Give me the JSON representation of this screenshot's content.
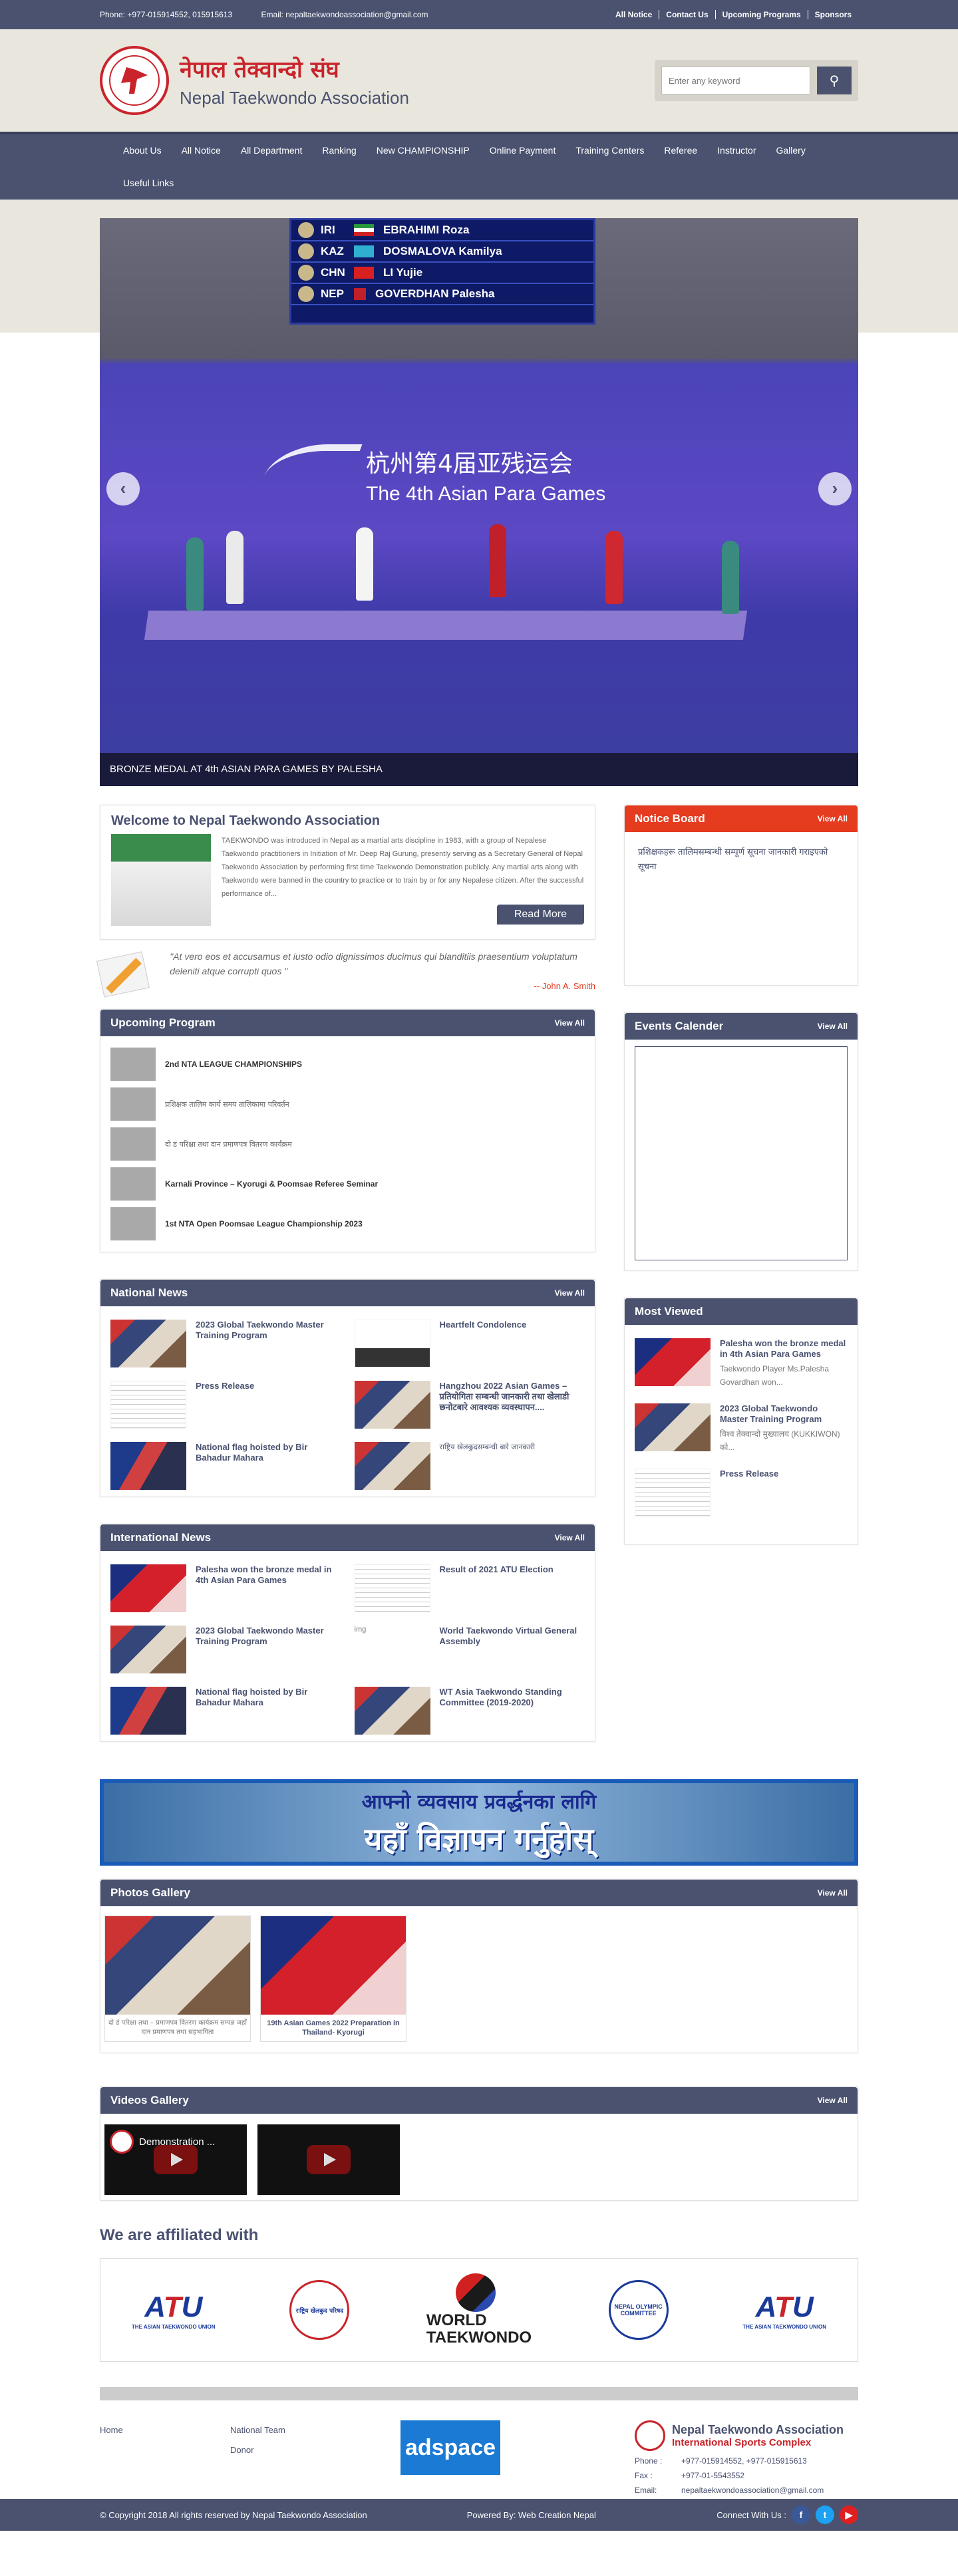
{
  "topbar": {
    "phone": "Phone: +977-015914552, 015915613",
    "email": "Email: nepaltaekwondoassociation@gmail.com",
    "links": [
      "All Notice",
      "Contact Us",
      "Upcoming Programs",
      "Sponsors"
    ]
  },
  "header": {
    "title_np": "नेपाल तेक्वान्दो संघ",
    "title_en": "Nepal Taekwondo Association",
    "search_placeholder": "Enter any keyword"
  },
  "nav": [
    "About Us",
    "All Notice",
    "All Department",
    "Ranking",
    "New CHAMPIONSHIP",
    "Online Payment",
    "Training Centers",
    "Referee",
    "Instructor",
    "Gallery",
    "Useful Links"
  ],
  "slider": {
    "caption": "BRONZE MEDAL AT 4th ASIAN PARA GAMES BY PALESHA",
    "scoreboard": [
      {
        "code": "IRI",
        "name": "EBRAHIMI Roza"
      },
      {
        "code": "KAZ",
        "name": "DOSMALOVA Kamilya"
      },
      {
        "code": "CHN",
        "name": "LI Yujie"
      },
      {
        "code": "NEP",
        "name": "GOVERDHAN Palesha"
      }
    ],
    "games_cn": "杭州第4届亚残运会",
    "games_en": "The 4th Asian Para Games"
  },
  "welcome": {
    "title": "Welcome to Nepal Taekwondo Association",
    "text": "TAEKWONDO was introduced in Nepal as a martial arts discipline in 1983, with a group of Nepalese Taekwondo practitioners in Initiation of Mr. Deep Raj Gurung, presently serving as a Secretary General of Nepal Taekwondo Association by performing first time Taekwondo Demonstration publicly. Any martial arts along with Taekwondo were banned in the country to practice or to train by or for any Nepalese citizen. After the successful performance of...",
    "read_more": "Read More"
  },
  "quote": {
    "text": "\"At vero eos et accusamus et iusto odio dignissimos ducimus qui blanditiis praesentium voluptatum deleniti atque corrupti quos \"",
    "author": "-- John A. Smith"
  },
  "upcoming": {
    "title": "Upcoming Program",
    "view_all": "View All",
    "items": [
      {
        "text": "2nd NTA LEAGUE CHAMPIONSHIPS",
        "np": false
      },
      {
        "text": "प्रशिक्षक तालिम कार्य समय तालिकामा परिवर्तन",
        "np": true
      },
      {
        "text": "दो डं परिक्षा तथा दान प्रमाणपत्र वितरण कार्यक्रम",
        "np": true
      },
      {
        "text": "Karnali Province – Kyorugi & Poomsae Referee Seminar",
        "np": false
      },
      {
        "text": "1st NTA Open Poomsae League Championship 2023",
        "np": false
      }
    ]
  },
  "national_news": {
    "title": "National News",
    "view_all": "View All",
    "items": [
      {
        "text": "2023 Global Taekwondo Master Training Program",
        "img": "people",
        "np": false
      },
      {
        "text": "Heartfelt Condolence",
        "img": "ribbon",
        "np": false
      },
      {
        "text": "Press Release",
        "img": "doc",
        "np": false
      },
      {
        "text": "Hangzhou 2022 Asian Games – प्रतियोगिता सम्बन्धी जानकारी तथा खेलाडी छनोटबारे आवश्यक व्यवस्थापन....",
        "img": "people",
        "np": false
      },
      {
        "text": "National flag hoisted by Bir Bahadur Mahara",
        "img": "flag",
        "np": false
      },
      {
        "text": "राष्ट्रिय खेलकुदसम्बन्धी बारे जानकारी",
        "img": "people",
        "np": true
      }
    ]
  },
  "international_news": {
    "title": "International News",
    "view_all": "View All",
    "items": [
      {
        "text": "Palesha won the bronze medal in 4th Asian Para Games",
        "img": "red"
      },
      {
        "text": "Result of 2021 ATU Election",
        "img": "doc"
      },
      {
        "text": "2023 Global Taekwondo Master Training Program",
        "img": "people"
      },
      {
        "text": "World Taekwondo Virtual General Assembly",
        "img": "text"
      },
      {
        "text": "National flag hoisted by Bir Bahadur Mahara",
        "img": "flag"
      },
      {
        "text": "WT Asia Taekwondo Standing Committee (2019-2020)",
        "img": "people"
      }
    ],
    "img_alt": "img"
  },
  "notice_board": {
    "title": "Notice Board",
    "view_all": "View All",
    "text": "प्रशिक्षकहरू तालिमसम्बन्धी सम्पूर्ण सूचना जानकारी गराइएको सूचना"
  },
  "events": {
    "title": "Events Calender",
    "view_all": "View All"
  },
  "most_viewed": {
    "title": "Most Viewed",
    "items": [
      {
        "title": "Palesha won the bronze medal in 4th Asian Para Games",
        "desc": "Taekwondo Player Ms.Palesha Govardhan won...",
        "img": "red"
      },
      {
        "title": "2023 Global Taekwondo Master Training Program",
        "desc": "विश्व तेक्वान्दो मुख्यालय (KUKKIWON) को...",
        "img": "people"
      },
      {
        "title": "Press Release",
        "desc": "",
        "img": "doc"
      }
    ]
  },
  "ad": {
    "line1": "आफ्नो व्यवसाय प्रवर्द्धनका लागि",
    "line2": "यहाँ विज्ञापन गर्नुहोस्"
  },
  "photos": {
    "title": "Photos Gallery",
    "view_all": "View All",
    "items": [
      {
        "caption": "दो डं परिक्षा तथा – प्रमाणपत्र वितरण कार्यक्रम सम्पन्न जहाँ दान प्रमाणपत्र तथा सहभागिता",
        "np": true
      },
      {
        "caption": "19th Asian Games 2022 Preparation in Thailand- Kyorugi",
        "np": false
      }
    ]
  },
  "videos": {
    "title": "Videos Gallery",
    "view_all": "View All",
    "items": [
      "Demonstration ..."
    ]
  },
  "affiliated": {
    "title": "We are affiliated with",
    "atu_sub": "THE ASIAN TAEKWONDO UNION",
    "nsc": "राष्ट्रिय खेलकुद परिषद",
    "noc": "NEPAL OLYMPIC COMMITTEE",
    "wt": [
      "WORLD",
      "TAEKWONDO"
    ]
  },
  "footer": {
    "col1": [
      "Home"
    ],
    "col2": [
      "National Team",
      "Donor"
    ],
    "adspace": "adspace",
    "org_name": "Nepal Taekwondo Association",
    "org_sub": "International Sports Complex",
    "phone_label": "Phone :",
    "phone": "+977-015914552, +977-015915613",
    "fax_label": "Fax :",
    "fax": "+977-01-5543552",
    "email_label": "Email:",
    "email": "nepaltaekwondoassociation@gmail.com"
  },
  "bottombar": {
    "copyright": "© Copyright 2018 All rights reserved by Nepal Taekwondo Association",
    "powered": "Powered By: Web Creation Nepal",
    "connect": "Connect With Us :"
  },
  "colors": {
    "primary": "#4a5270",
    "accent_red": "#e53b1f",
    "brand_red": "#c9242b",
    "cream": "#e9e7dd"
  }
}
